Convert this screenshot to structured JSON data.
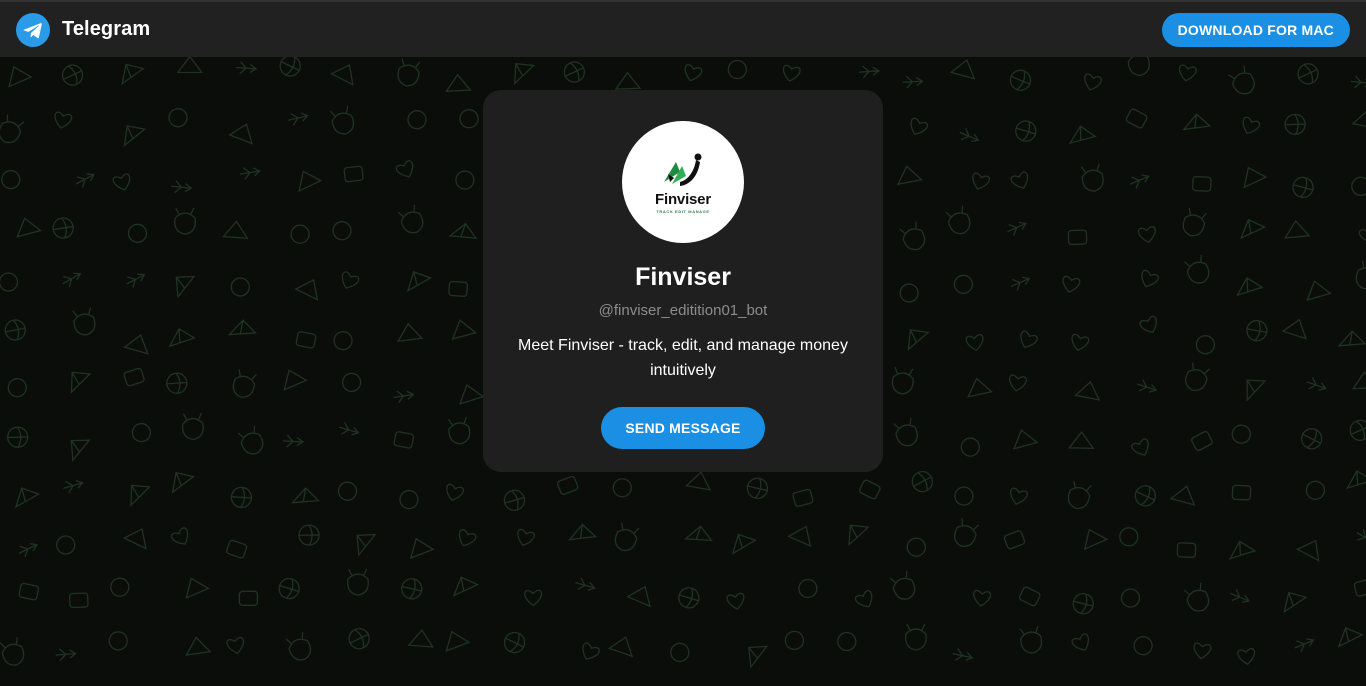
{
  "header": {
    "app_name": "Telegram",
    "download_label": "DOWNLOAD FOR MAC"
  },
  "profile": {
    "avatar_wordmark": "Finviser",
    "avatar_tagline": "TRACK EDIT MANAGE",
    "name": "Finviser",
    "username": "@finviser_editition01_bot",
    "description": "Meet Finviser - track, edit, and manage money intuitively",
    "send_label": "SEND MESSAGE"
  },
  "colors": {
    "accent": "#1a8fe3",
    "topbar": "#212121",
    "card": "#1f1f1f",
    "background": "#0b0d0b",
    "pattern_stroke": "#1f3320"
  },
  "icons": {
    "logo": "telegram-paper-plane-icon",
    "background": "doodle-pattern"
  }
}
